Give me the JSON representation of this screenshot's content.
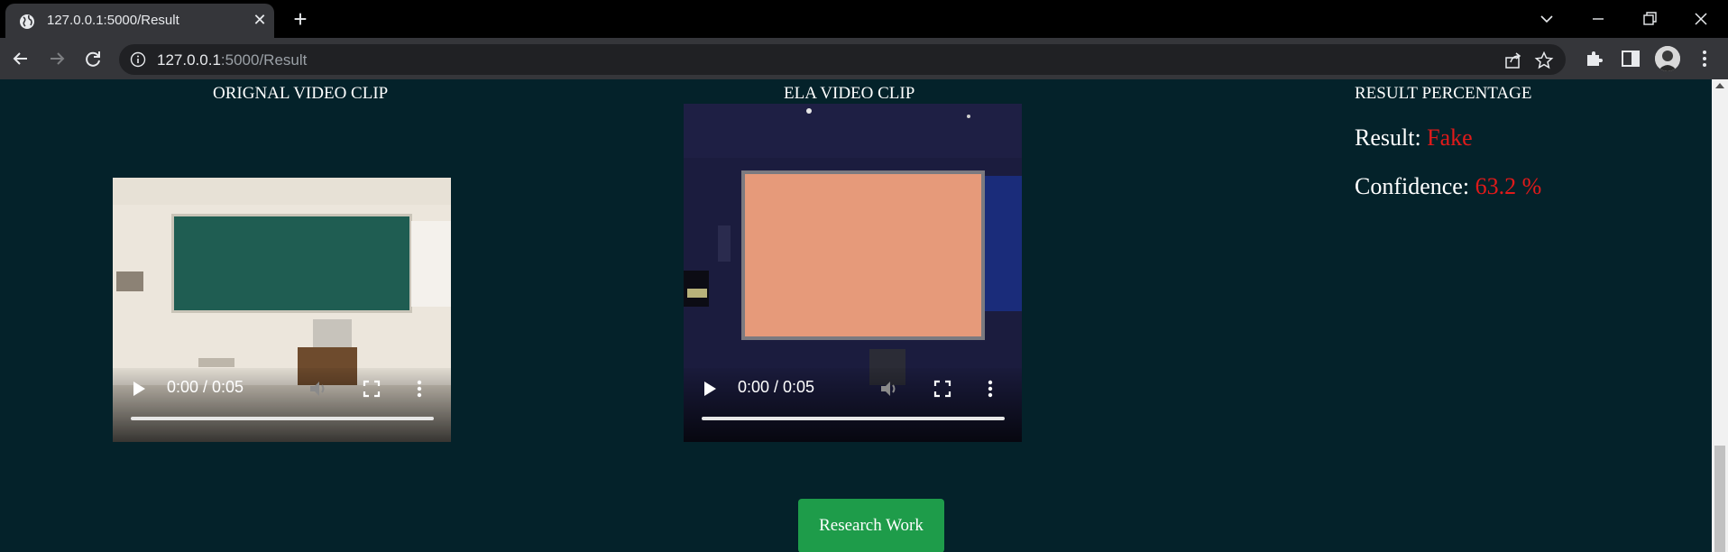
{
  "browser": {
    "tab_title": "127.0.0.1:5000/Result",
    "url_host": "127.0.0.1",
    "url_rest": ":5000/Result"
  },
  "page": {
    "original": {
      "heading": "ORIGNAL VIDEO CLIP",
      "time": "0:00 / 0:05"
    },
    "ela": {
      "heading": "ELA VIDEO CLIP",
      "time": "0:00 / 0:05"
    },
    "result": {
      "heading": "RESULT PERCENTAGE",
      "result_label": "Result:",
      "result_value": "Fake",
      "confidence_label": "Confidence:",
      "confidence_value": "63.2 %"
    },
    "research_button": "Research Work"
  },
  "colors": {
    "page_background": "#04222a",
    "accent_red": "#e01a1a",
    "button_green": "#1e9c4a"
  }
}
